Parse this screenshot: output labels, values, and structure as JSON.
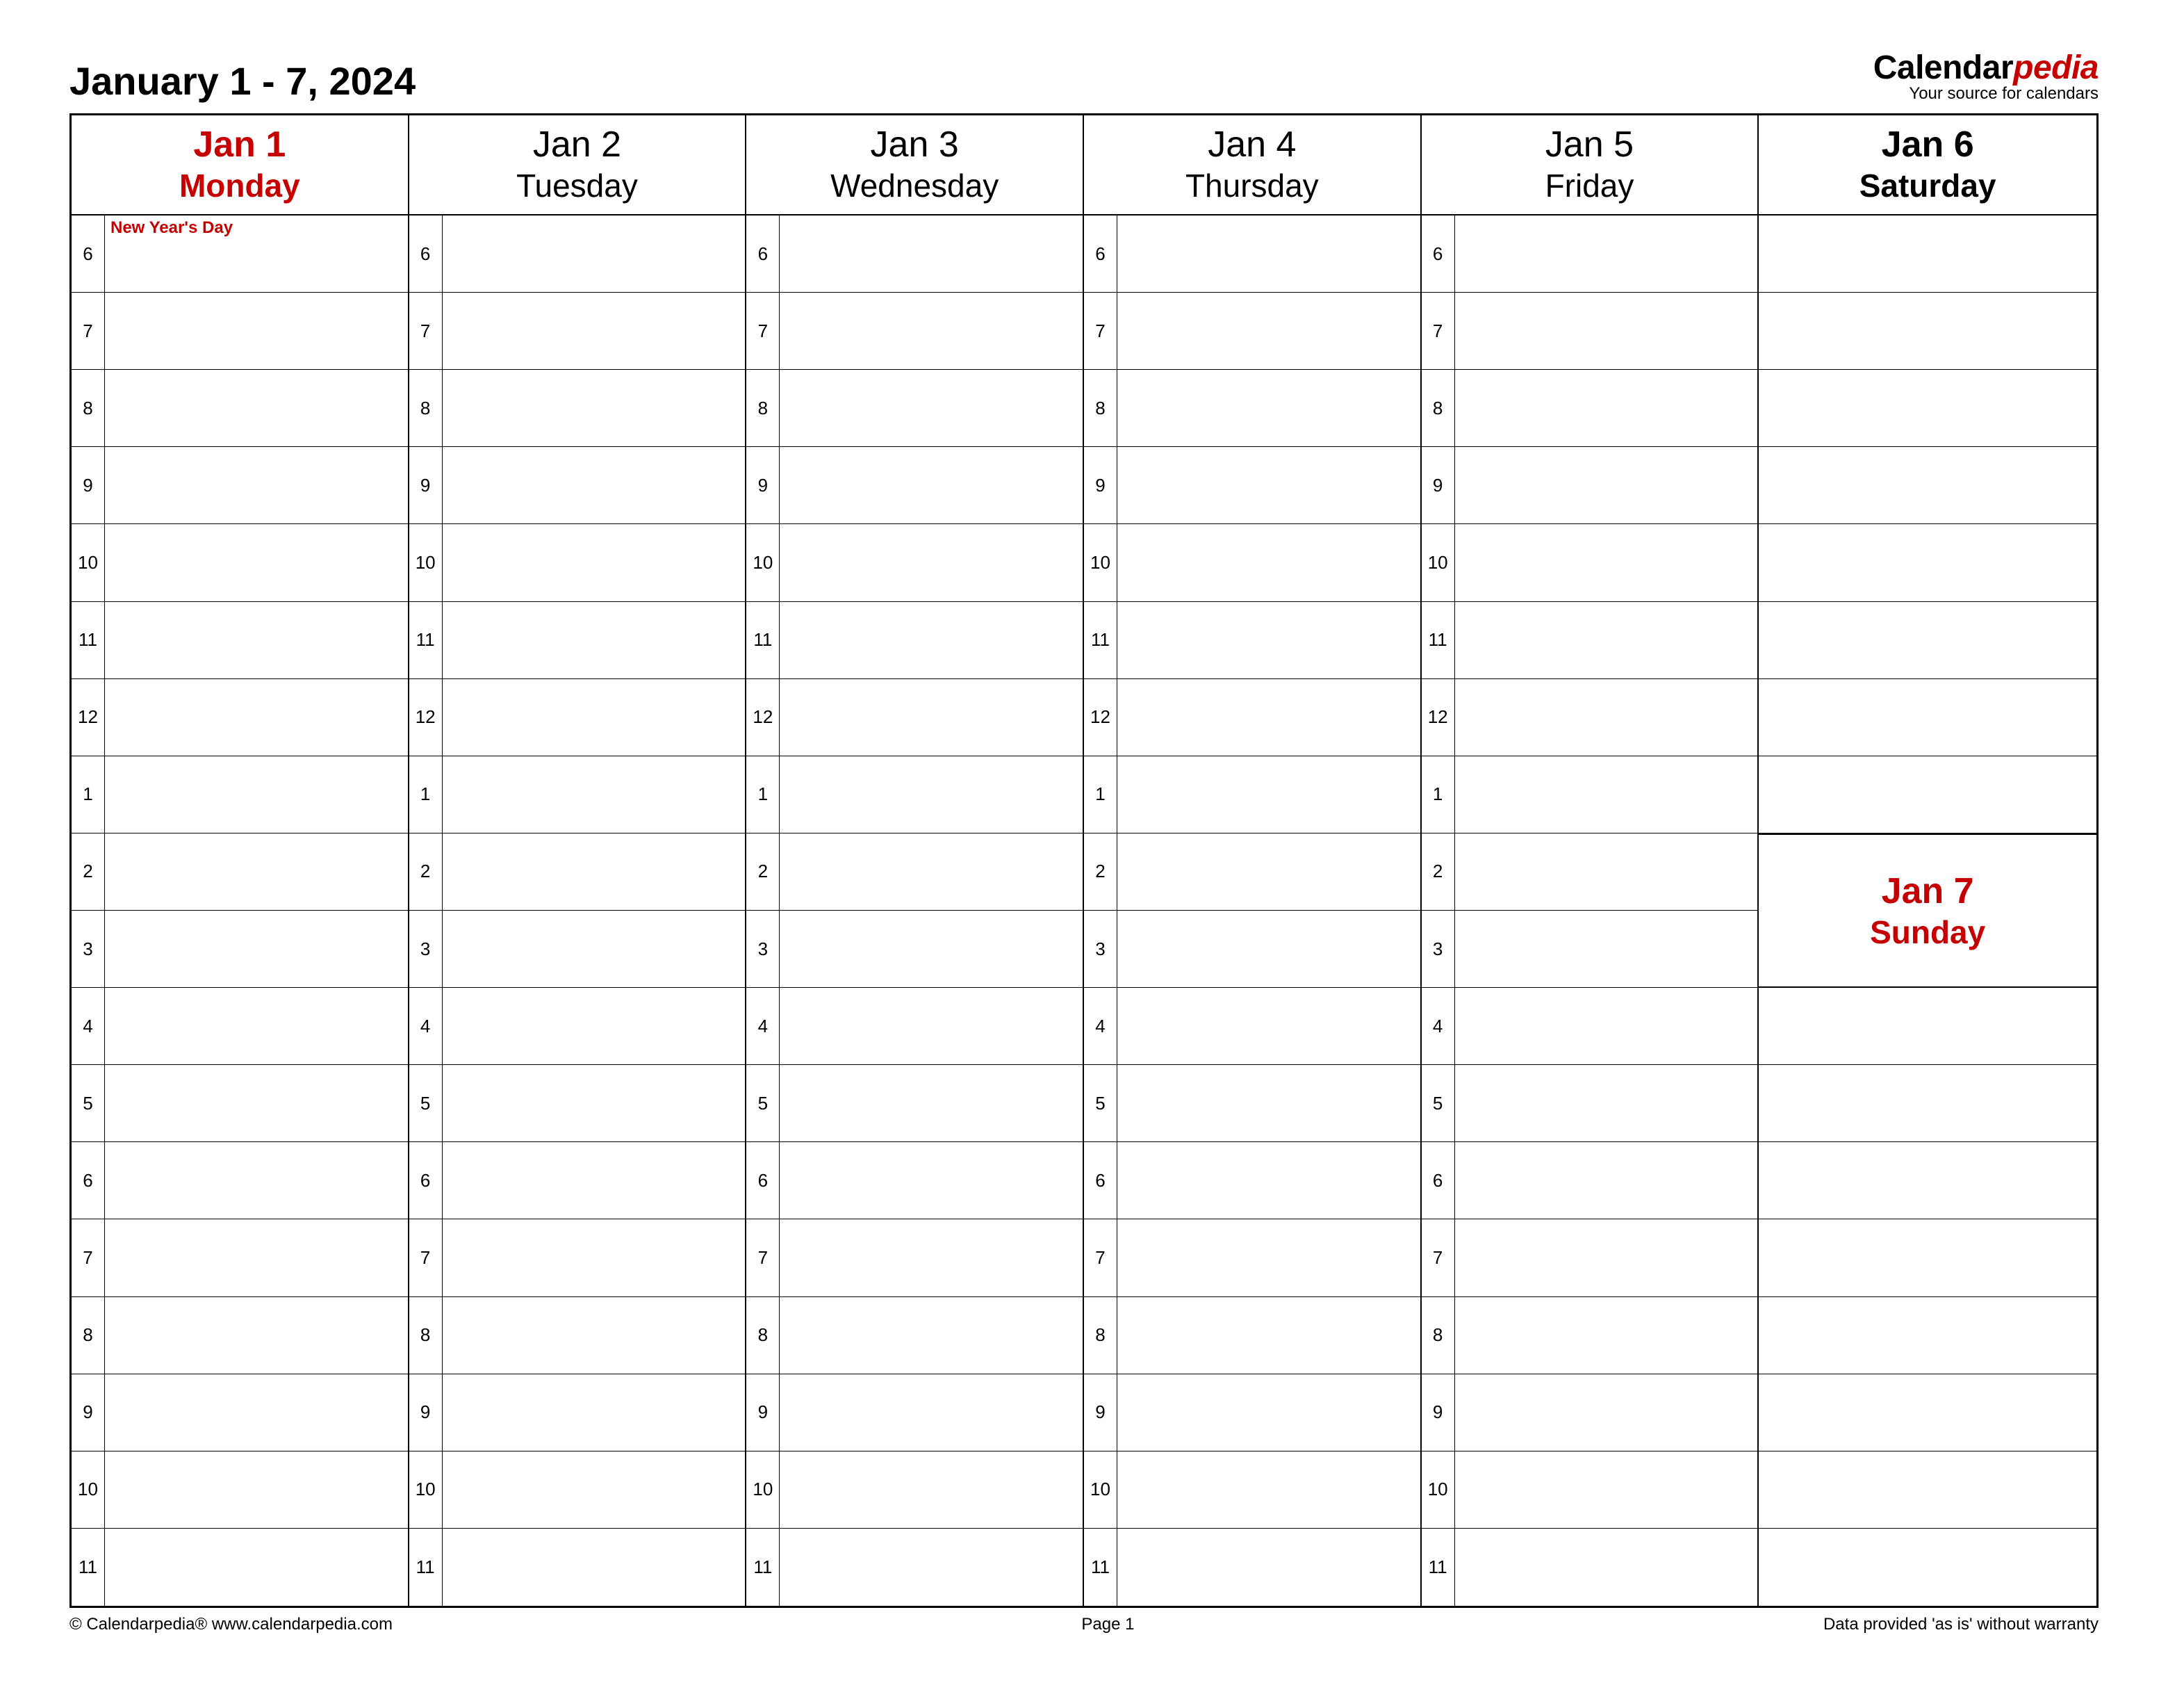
{
  "title": "January 1 - 7, 2024",
  "brand": {
    "part1": "Calendar",
    "part2": "pedia",
    "tagline": "Your source for calendars"
  },
  "hours": [
    "6",
    "7",
    "8",
    "9",
    "10",
    "11",
    "12",
    "1",
    "2",
    "3",
    "4",
    "5",
    "6",
    "7",
    "8",
    "9",
    "10",
    "11"
  ],
  "days": [
    {
      "date": "Jan 1",
      "dow": "Monday",
      "style": "hol",
      "event_row0": "New Year's Day"
    },
    {
      "date": "Jan 2",
      "dow": "Tuesday",
      "style": "reg"
    },
    {
      "date": "Jan 3",
      "dow": "Wednesday",
      "style": "reg"
    },
    {
      "date": "Jan 4",
      "dow": "Thursday",
      "style": "reg"
    },
    {
      "date": "Jan 5",
      "dow": "Friday",
      "style": "reg"
    }
  ],
  "saturday": {
    "date": "Jan 6",
    "dow": "Saturday"
  },
  "sunday": {
    "date": "Jan 7",
    "dow": "Sunday"
  },
  "footer": {
    "left": "© Calendarpedia®   www.calendarpedia.com",
    "center": "Page 1",
    "right": "Data provided 'as is' without warranty"
  }
}
